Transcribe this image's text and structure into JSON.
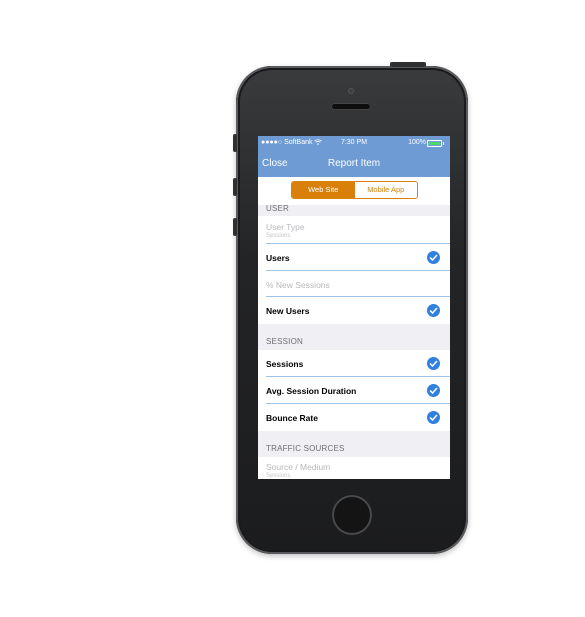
{
  "status_bar": {
    "carrier": "●●●●○ SoftBank ",
    "time": "7:30 PM",
    "battery": "100%",
    "battery_level": 1.0,
    "battery_color": "#4cd964"
  },
  "nav": {
    "close_label": "Close",
    "title": "Report Item"
  },
  "segment": {
    "options": [
      "Web Site",
      "Mobile App"
    ],
    "selected": "Web Site",
    "accent": "#d9800a"
  },
  "sections": {
    "user": {
      "header": "USER",
      "rows": [
        {
          "label": "User Type",
          "sub": "Sessions",
          "enabled": false
        },
        {
          "label": "Users",
          "checked": true
        },
        {
          "label": "% New Sessions",
          "enabled": false
        },
        {
          "label": "New Users",
          "checked": true
        }
      ]
    },
    "session": {
      "header": "SESSION",
      "rows": [
        {
          "label": "Sessions",
          "checked": true
        },
        {
          "label": "Avg. Session Duration",
          "checked": true
        },
        {
          "label": "Bounce Rate",
          "checked": true
        }
      ]
    },
    "traffic": {
      "header": "TRAFFIC SOURCES",
      "rows": [
        {
          "label": "Source / Medium",
          "sub": "Sessions",
          "enabled": false
        }
      ]
    }
  },
  "colors": {
    "nav_bar": "#6e9bd3",
    "check": "#2f80e0",
    "background": "#efeff4"
  },
  "icons": {
    "wifi": "wifi-icon",
    "battery": "battery-icon",
    "check": "checkmark-circle-icon"
  }
}
